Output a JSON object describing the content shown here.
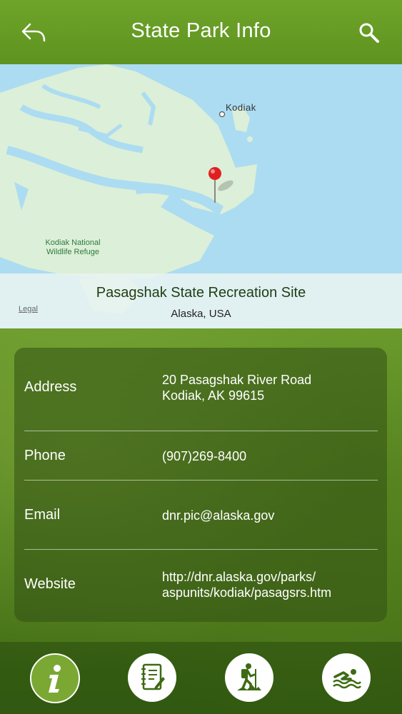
{
  "header": {
    "title": "State Park Info",
    "back_icon": "back-arrow-icon",
    "search_icon": "search-icon"
  },
  "map": {
    "city_label": "Kodiak",
    "refuge_label_line1": "Kodiak National",
    "refuge_label_line2": "Wildlife Refuge",
    "place_name": "Pasagshak State Recreation Site",
    "place_region": "Alaska, USA",
    "legal_label": "Legal"
  },
  "info": {
    "rows": [
      {
        "label": "Address",
        "value_line1": "20 Pasagshak River Road",
        "value_line2": "Kodiak, AK 99615"
      },
      {
        "label": "Phone",
        "value_line1": "(907)269-8400"
      },
      {
        "label": "Email",
        "value_line1": "dnr.pic@alaska.gov"
      },
      {
        "label": "Website",
        "value_line1": "http://dnr.alaska.gov/parks/",
        "value_line2": "aspunits/kodiak/pasagsrs.htm"
      }
    ]
  },
  "tabbar": {
    "tabs": [
      {
        "icon": "info-icon",
        "active": true
      },
      {
        "icon": "notebook-icon",
        "active": false
      },
      {
        "icon": "hiker-icon",
        "active": false
      },
      {
        "icon": "swimmer-icon",
        "active": false
      }
    ]
  },
  "colors": {
    "header_green": "#6fa42a",
    "active_tab": "#7aa832",
    "pin_red": "#e02020"
  }
}
